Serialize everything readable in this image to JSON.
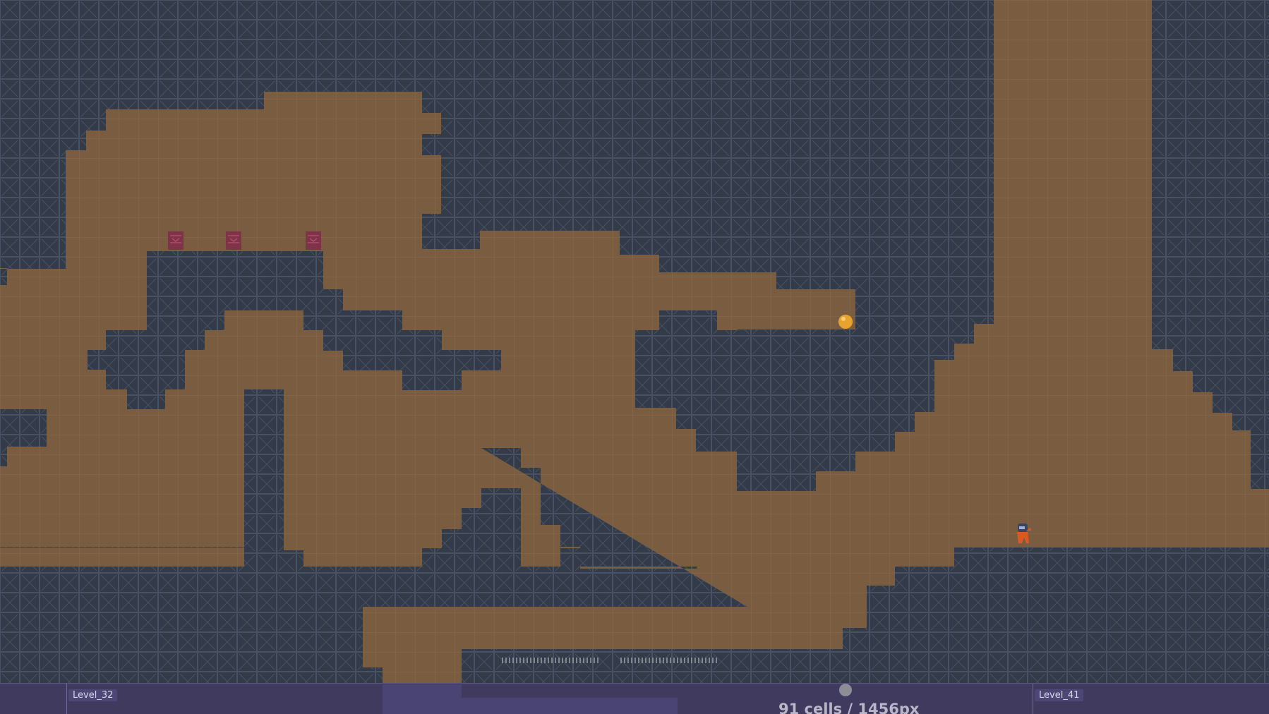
{
  "scene": {
    "colors": {
      "wall": "#343b48",
      "wall_line": "#485264",
      "floor": "#7a5d40",
      "floor_grid": "#876a4b",
      "coin": "#e8a32e",
      "crate": "#7e3349",
      "spikes": "#9aa0a8",
      "player_body": "#d85a22",
      "player_head": "#3a4462"
    }
  },
  "hud": {
    "levels": [
      {
        "label": "Level_32"
      },
      {
        "label": "Level_41"
      }
    ],
    "cell_readout": "91 cells / 1456px"
  }
}
